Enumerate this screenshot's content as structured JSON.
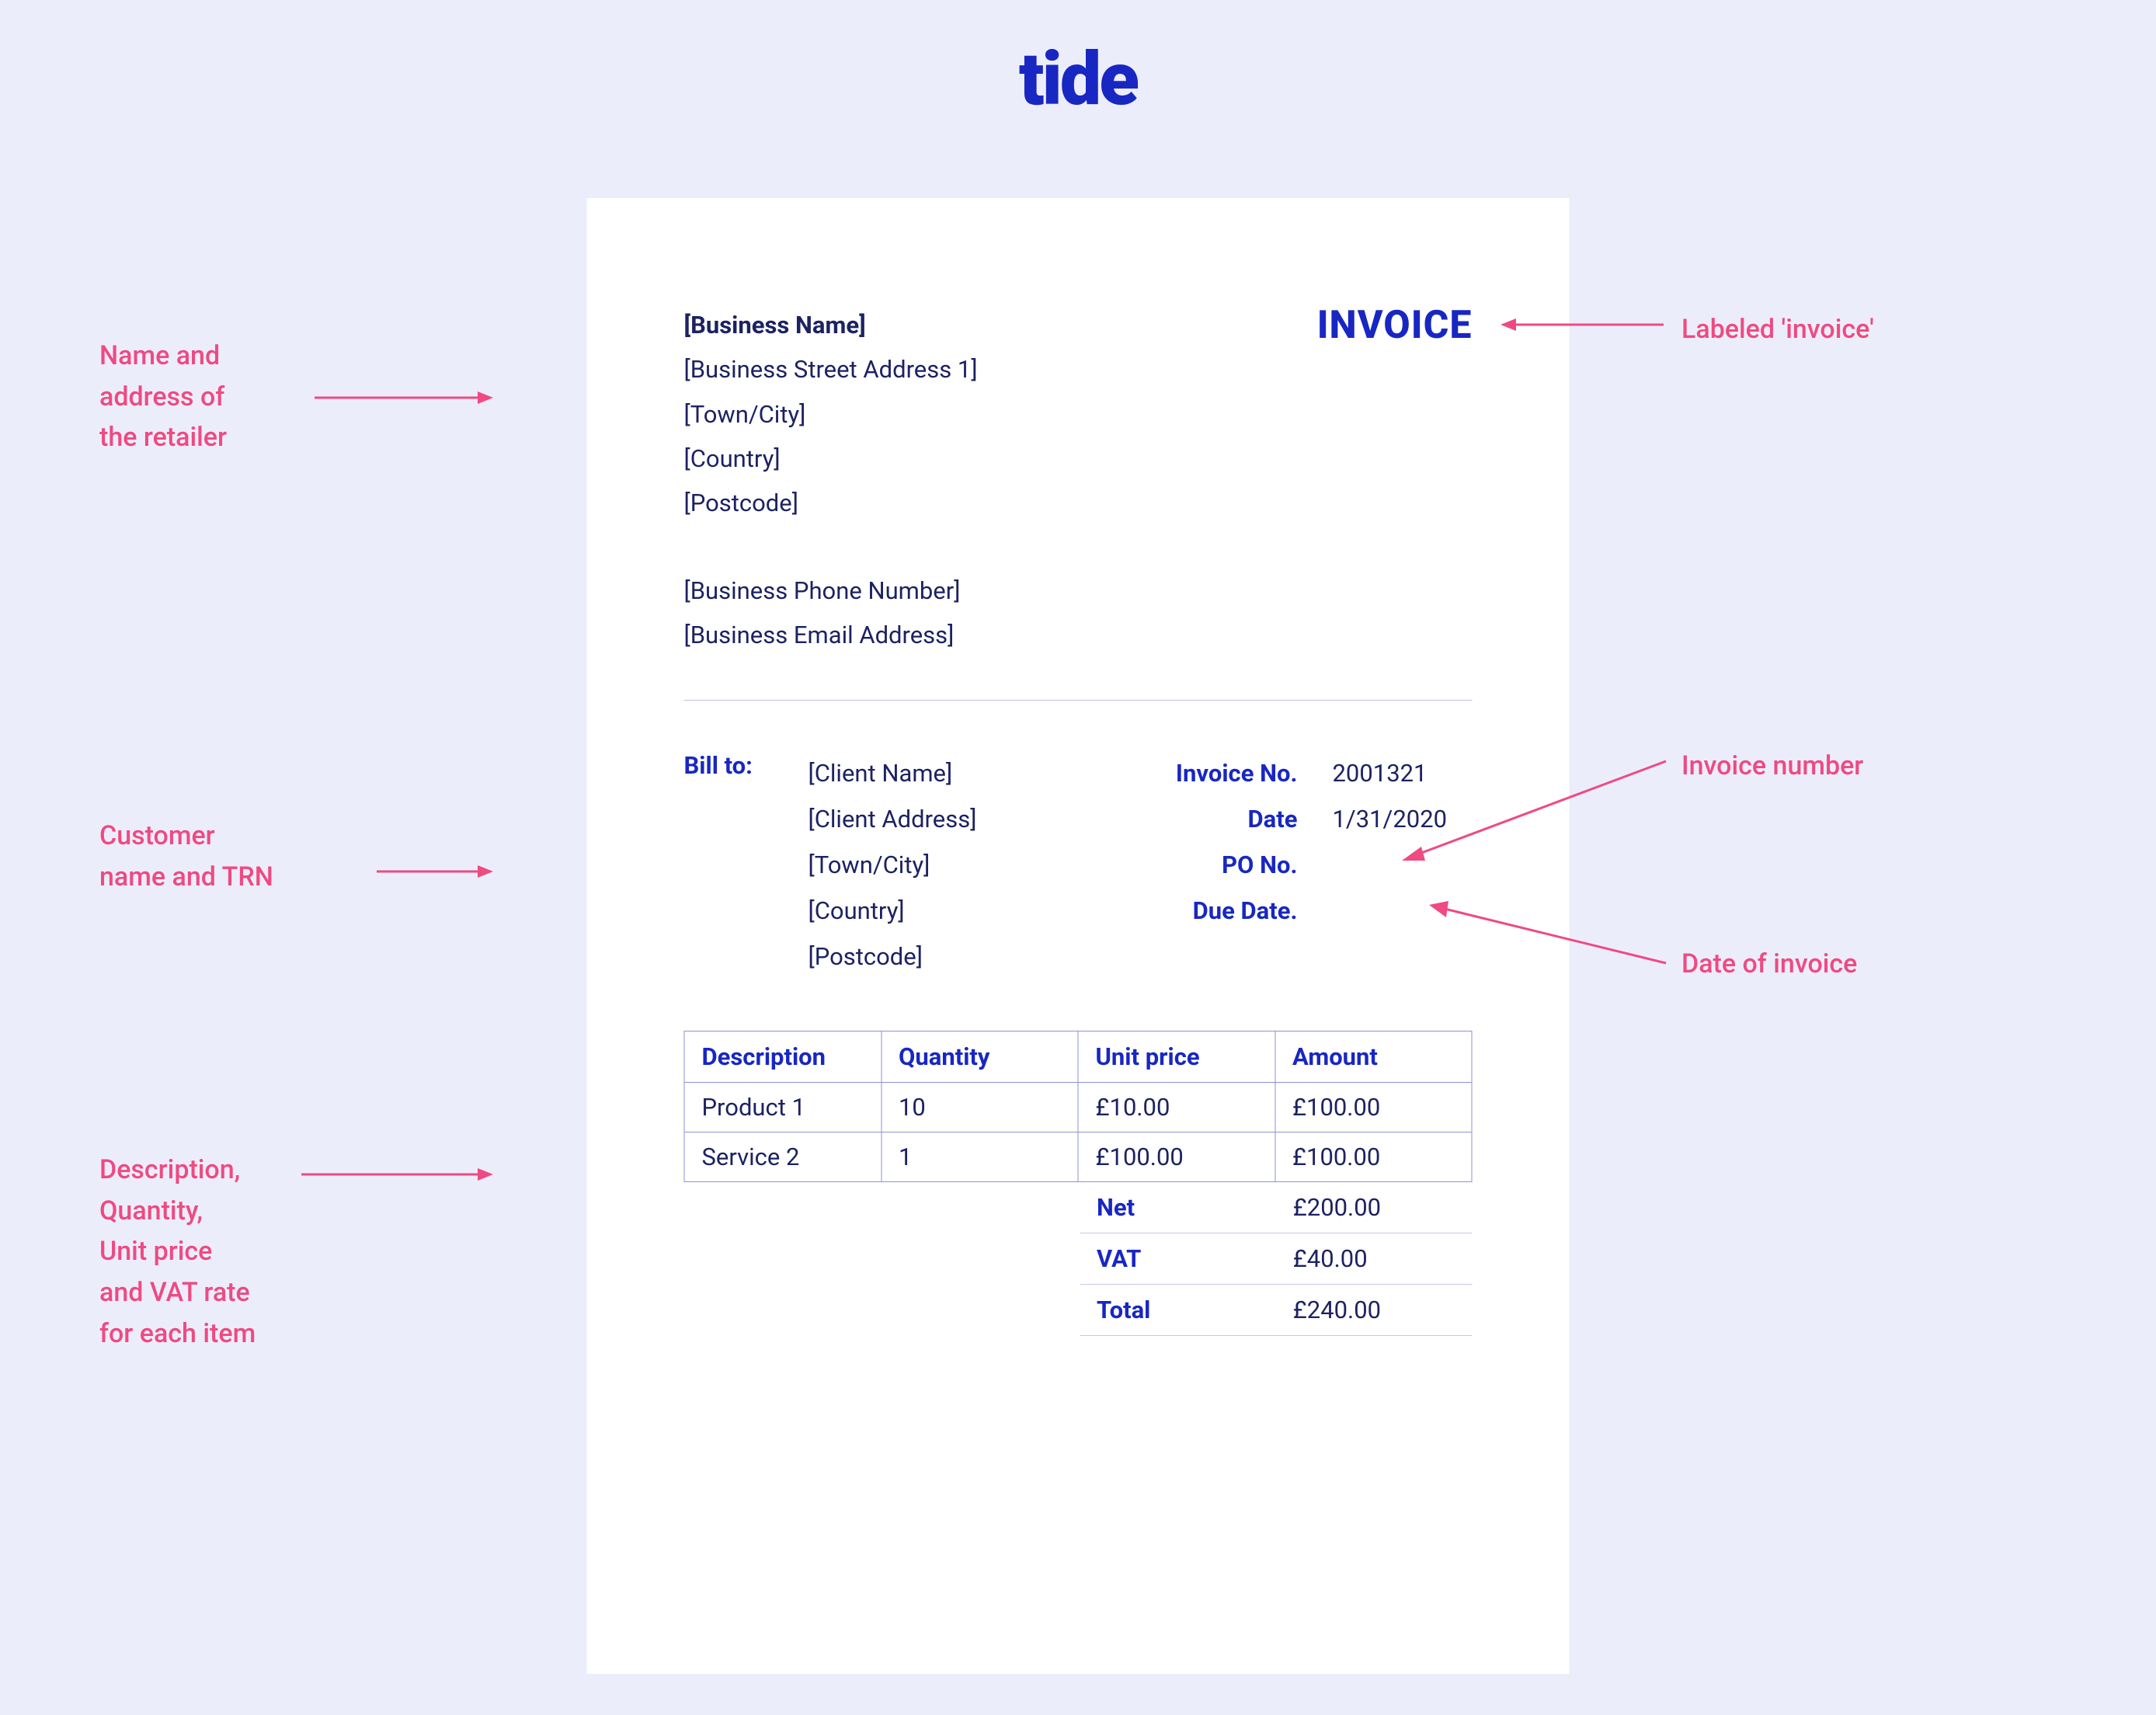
{
  "brand": "tide",
  "invoice_title": "INVOICE",
  "business": {
    "name": "[Business Name]",
    "street": "[Business Street Address 1]",
    "town": "[Town/City]",
    "country": "[Country]",
    "postcode": "[Postcode]",
    "phone": "[Business Phone Number]",
    "email": "[Business Email Address]"
  },
  "bill_to_label": "Bill to:",
  "client": {
    "name": "[Client Name]",
    "address": "[Client Address]",
    "town": "[Town/City]",
    "country": "[Country]",
    "postcode": "[Postcode]"
  },
  "meta": {
    "invoice_no_label": "Invoice No.",
    "invoice_no": "2001321",
    "date_label": "Date",
    "date": "1/31/2020",
    "po_label": "PO No.",
    "po": "",
    "due_label": "Due Date.",
    "due": ""
  },
  "table": {
    "headers": {
      "desc": "Description",
      "qty": "Quantity",
      "price": "Unit price",
      "amount": "Amount"
    },
    "rows": [
      {
        "desc": "Product 1",
        "qty": "10",
        "price": "£10.00",
        "amount": "£100.00"
      },
      {
        "desc": "Service 2",
        "qty": "1",
        "price": "£100.00",
        "amount": "£100.00"
      }
    ]
  },
  "totals": {
    "net_label": "Net",
    "net": "£200.00",
    "vat_label": "VAT",
    "vat": "£40.00",
    "total_label": "Total",
    "total": "£240.00"
  },
  "annotations": {
    "retailer": "Name and\naddress of\nthe retailer",
    "labeled": "Labeled 'invoice'",
    "customer": "Customer\nname and TRN",
    "invoice_number": "Invoice number",
    "date_of_invoice": "Date of invoice",
    "items": "Description,\nQuantity,\nUnit price\nand VAT rate\nfor each item"
  }
}
